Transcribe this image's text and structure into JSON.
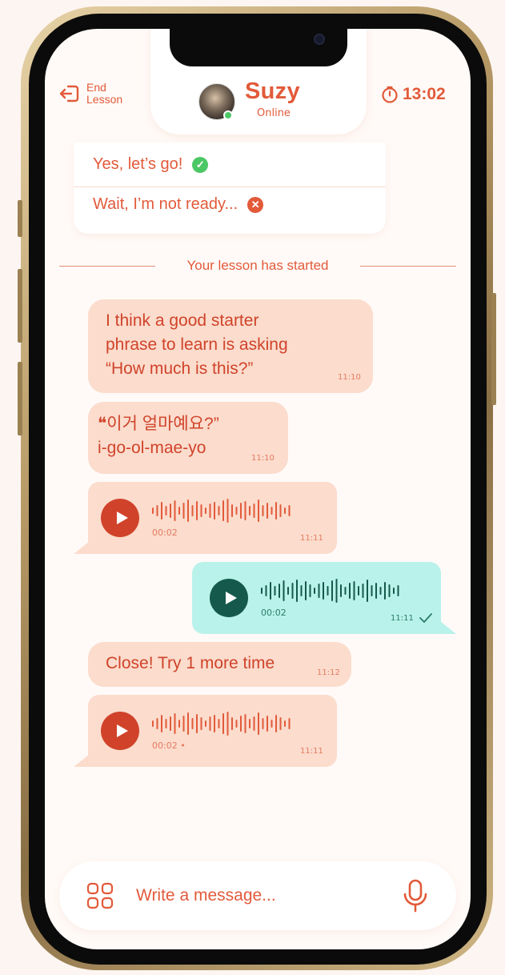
{
  "header": {
    "end_label_line1": "End",
    "end_label_line2": "Lesson",
    "contact_name": "Suzy",
    "contact_status": "Online",
    "timer": "13:02"
  },
  "options": [
    {
      "label": "Yes, let’s go!",
      "icon": "check-circle-icon"
    },
    {
      "label": "Wait, I’m not ready...",
      "icon": "x-circle-icon"
    }
  ],
  "separator": "Your lesson has started",
  "messages": [
    {
      "type": "text",
      "direction": "incoming",
      "lines": [
        "I think a good starter",
        "phrase to learn is asking",
        "“How much is this?”"
      ],
      "time": "11:10"
    },
    {
      "type": "text",
      "direction": "incoming",
      "lines": [
        "❝이거 얼마예요?”",
        "i-go-ol-mae-yo"
      ],
      "time": "11:10"
    },
    {
      "type": "voice",
      "direction": "incoming",
      "duration": "00:02",
      "time": "11:11"
    },
    {
      "type": "voice",
      "direction": "outgoing",
      "duration": "00:02",
      "time": "11:11",
      "read": true
    },
    {
      "type": "text",
      "direction": "incoming",
      "lines": [
        "Close! Try 1 more time"
      ],
      "time": "11:12"
    },
    {
      "type": "voice",
      "direction": "incoming",
      "duration": "00:02 •",
      "time": "11:11"
    }
  ],
  "composer": {
    "placeholder": "Write a message..."
  },
  "colors": {
    "accent": "#e25a3a",
    "incoming_bubble": "#fbdccd",
    "outgoing_bubble": "#b9f2ea",
    "outgoing_dark": "#15594c",
    "online": "#4cc765",
    "background": "#fffaf7"
  }
}
